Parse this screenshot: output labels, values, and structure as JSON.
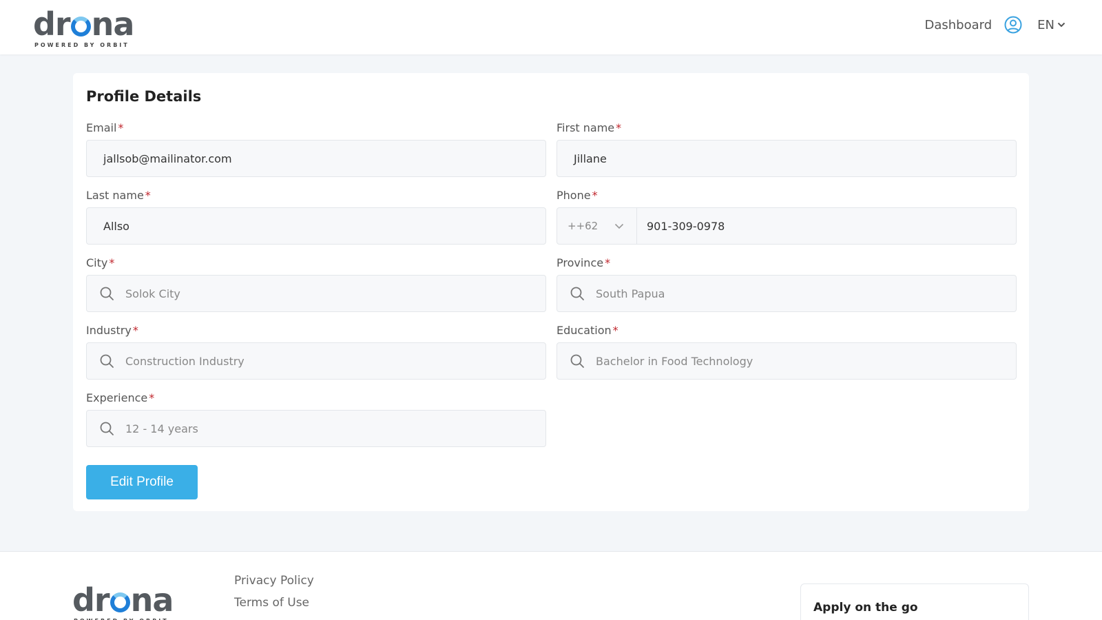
{
  "brand": {
    "name_prefix": "dr",
    "name_suffix": "na",
    "tagline": "POWERED BY ORBIT"
  },
  "nav": {
    "dashboard_label": "Dashboard",
    "language": "EN"
  },
  "profile": {
    "title": "Profile Details",
    "fields": {
      "email": {
        "label": "Email",
        "value": "jallsob@mailinator.com"
      },
      "first_name": {
        "label": "First name",
        "value": "Jillane"
      },
      "last_name": {
        "label": "Last name",
        "value": "Allso"
      },
      "phone": {
        "label": "Phone",
        "code": "++62",
        "value": "901-309-0978"
      },
      "city": {
        "label": "City",
        "value": "Solok City"
      },
      "province": {
        "label": "Province",
        "value": "South Papua"
      },
      "industry": {
        "label": "Industry",
        "value": "Construction Industry"
      },
      "education": {
        "label": "Education",
        "value": "Bachelor in Food Technology"
      },
      "experience": {
        "label": "Experience",
        "value": "12 - 14 years"
      }
    },
    "required_marker": "*",
    "edit_button": "Edit Profile"
  },
  "footer": {
    "links": [
      "Privacy Policy",
      "Terms of Use"
    ],
    "apply_title": "Apply on the go"
  },
  "colors": {
    "accent": "#3aafe7",
    "logo_ring": "#1f7fd8",
    "required": "#c0262d",
    "background": "#f3f6f9"
  }
}
